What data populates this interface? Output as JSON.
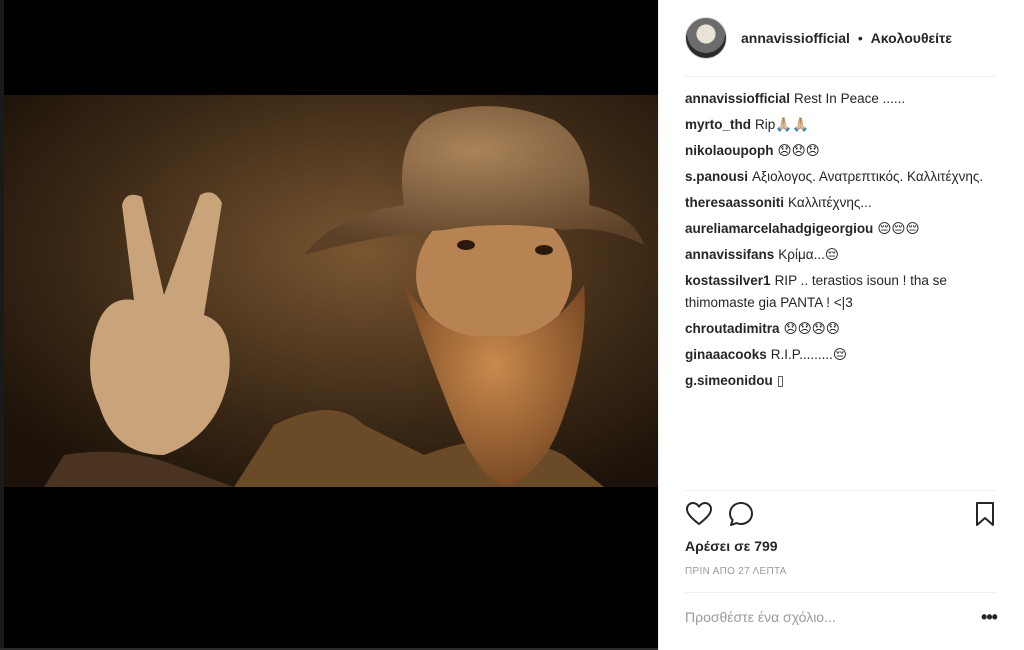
{
  "post": {
    "username": "annavissiofficial",
    "separator": "•",
    "follow_label": "Ακολουθείτε",
    "photo_alt": "Portrait of a bearded man in a hat making a peace sign"
  },
  "comments": [
    {
      "user": "annavissiofficial",
      "text": "Rest In Peace ......"
    },
    {
      "user": "myrto_thd",
      "text": "Rip🙏🏼🙏🏼"
    },
    {
      "user": "nikolaoupoph",
      "text": "😞😞😞"
    },
    {
      "user": "s.panousi",
      "text": "Αξιολογος. Ανατρεπτικός. Καλλιτέχνης."
    },
    {
      "user": "theresaassoniti",
      "text": "Καλλιτέχνης..."
    },
    {
      "user": "aureliamarcelahadgigeorgiou",
      "text": "😔😔😔"
    },
    {
      "user": "annavissifans",
      "text": "Κρίμα...😔"
    },
    {
      "user": "kostassilver1",
      "text": "RIP .. terastios isoun ! tha se thimomaste gia PANTA ! <|3"
    },
    {
      "user": "chroutadimitra",
      "text": "😞😞😞😞"
    },
    {
      "user": "ginaaacooks",
      "text": "R.I.P.........😔"
    },
    {
      "user": "g.simeonidou",
      "text": "▯"
    }
  ],
  "stats": {
    "likes_label": "Αρέσει σε 799",
    "time_label": "ΠΡΙΝ ΑΠΟ 27 ΛΕΠΤΑ"
  },
  "add_comment": {
    "placeholder": "Προσθέστε ένα σχόλιο...",
    "value": ""
  },
  "more_label": "•••",
  "icons": {
    "like": "heart-icon",
    "comment": "comment-icon",
    "save": "bookmark-icon",
    "more": "more-options-icon"
  }
}
